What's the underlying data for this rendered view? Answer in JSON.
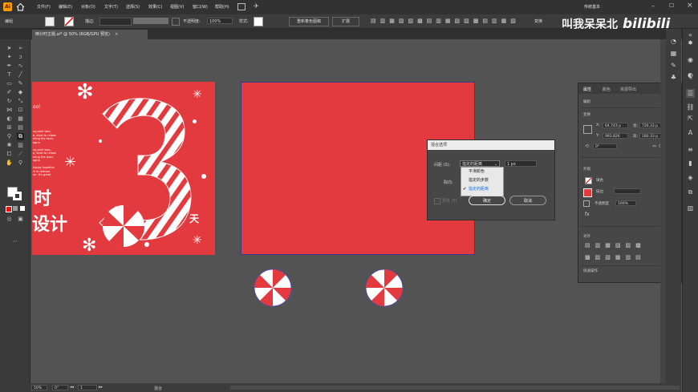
{
  "menu": {
    "items": [
      "文件(F)",
      "编辑(E)",
      "对象(O)",
      "文字(T)",
      "选择(S)",
      "效果(C)",
      "视图(V)",
      "窗口(W)",
      "帮助(H)"
    ],
    "right_label": "传统基本"
  },
  "control_bar": {
    "left_label": "编组",
    "stroke_label": "描边:",
    "opacity_label": "不透明度:",
    "opacity_value": "100%",
    "style_label": "样式:",
    "recolor_button": "重新着色图稿",
    "extend_button": "扩展",
    "transform_label": "变换"
  },
  "document": {
    "tab_title": "倒计时主题.ai* @ 50% (RGB/GPU 预览)"
  },
  "artboard1": {
    "text_line1": "时",
    "text_line2": "设计",
    "day_label": "天",
    "small_text": "ool Fen/ ful Fen ting A",
    "body_text": [
      "ng pork taro,",
      "e, start to releas",
      "ming the mod,",
      "agna",
      "",
      "ng pork taro,",
      "e, start to releas",
      "ming the mod,",
      "agna",
      "",
      "happy together",
      "rt to release",
      "on. It's great"
    ]
  },
  "dialog": {
    "title": "混合选项",
    "spacing_label": "间距 (S):",
    "spacing_selected": "指定的距离",
    "spacing_value": "1 px",
    "orientation_label": "取向:",
    "options": [
      "平滑颜色",
      "指定的步数",
      "指定的距离"
    ],
    "preview_label": "预览 (P)",
    "ok": "确定",
    "cancel": "取消"
  },
  "properties_panel": {
    "tabs": [
      "属性",
      "颜色",
      "资源导出"
    ],
    "section_group": "编组",
    "section_transform": "变换",
    "x_label": "X:",
    "x_value": "64.743 p",
    "y_label": "Y:",
    "y_value": "993.826",
    "w_label": "宽:",
    "w_value": "726.33 p",
    "h_label": "高:",
    "h_value": "180.33 p",
    "angle_value": "0°",
    "section_appearance": "外观",
    "fill_label": "填色",
    "stroke_label": "描边",
    "opacity_label": "不透明度",
    "opacity_value": "100%",
    "section_align": "对齐",
    "section_quick": "快速操作"
  },
  "status": {
    "zoom": "50%",
    "angle": "0°",
    "artboard_number": "1",
    "mode": "混合"
  },
  "watermark": {
    "text": "叫我呆呆北",
    "logo": "bilibili"
  },
  "colors": {
    "artboard_red": "#e23a3f",
    "ui_dark": "#323232",
    "canvas": "#535353"
  }
}
